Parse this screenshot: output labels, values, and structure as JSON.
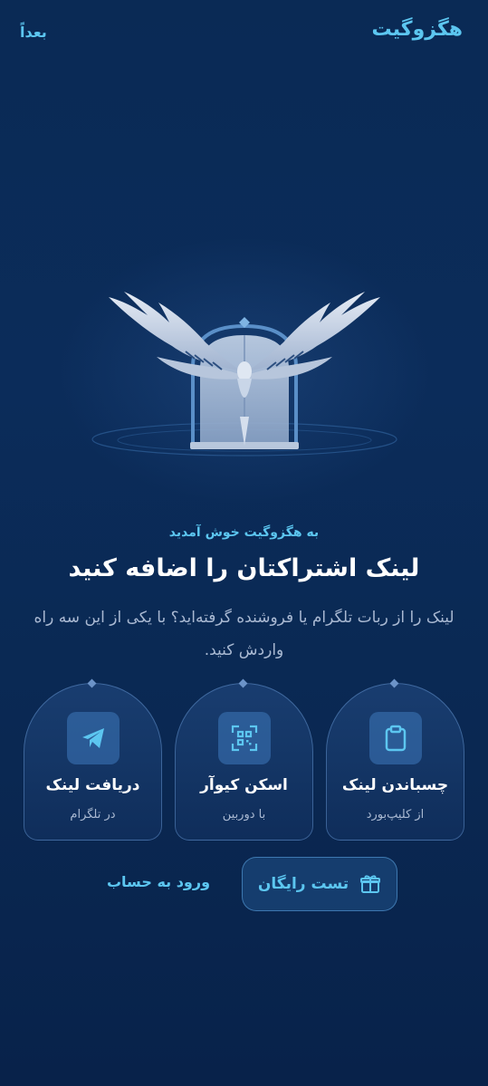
{
  "header": {
    "brand": "هگزوگیت",
    "later_label": "بعداً"
  },
  "hero": {
    "image": "winged-gate-illustration"
  },
  "intro": {
    "welcome": "به هگزوگیت خوش آمدید",
    "title": "لینک اشتراکتان را اضافه کنید",
    "subtitle": "لینک را از ربات تلگرام یا فروشنده گرفته‌اید؟ با یکی از این سه راه واردش کنید."
  },
  "options": [
    {
      "title": "چسباندن لینک",
      "subtitle": "از کلیپ‌بورد",
      "icon": "clipboard-icon"
    },
    {
      "title": "اسکن کیوآر",
      "subtitle": "با دوربین",
      "icon": "qr-scan-icon"
    },
    {
      "title": "دریافت لینک",
      "subtitle": "در تلگرام",
      "icon": "telegram-icon"
    }
  ],
  "actions": {
    "trial_label": "تست رایگان",
    "trial_icon": "gift-icon",
    "login_label": "ورود به حساب"
  },
  "colors": {
    "accent": "#5cc6f0",
    "background": "#0a2a55",
    "card_border": "#6ea0dc"
  }
}
